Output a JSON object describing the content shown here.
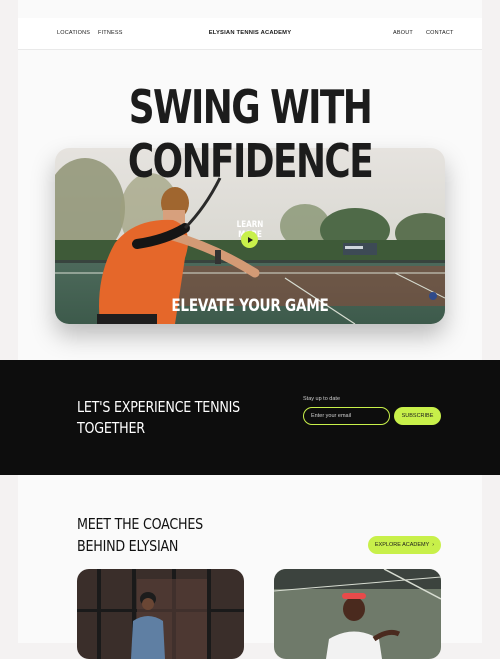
{
  "nav": {
    "left_links": [
      "LOCATIONS",
      "FITNESS"
    ],
    "brand": "ELYSIAN TENNIS ACADEMY",
    "right_links": [
      "ABOUT",
      "CONTACT"
    ]
  },
  "hero": {
    "title_line1": "SWING WITH",
    "title_line2": "CONFIDENCE",
    "learn_more": "LEARN MORE",
    "tagline": "ELEVATE YOUR GAME"
  },
  "newsletter": {
    "title_line1": "LET'S EXPERIENCE TENNIS",
    "title_line2": "TOGETHER",
    "label": "Stay up to date",
    "email_placeholder": "Enter your email",
    "subscribe_label": "SUBSCRIBE"
  },
  "coaches": {
    "title_line1": "MEET THE COACHES",
    "title_line2": "BEHIND ELYSIAN",
    "explore_label": "EXPLORE ACADEMY"
  },
  "colors": {
    "accent": "#c8f04a",
    "dark": "#0d0d0d",
    "background": "#fafafa"
  },
  "icons": [
    "play-icon",
    "chevron-right-icon"
  ]
}
